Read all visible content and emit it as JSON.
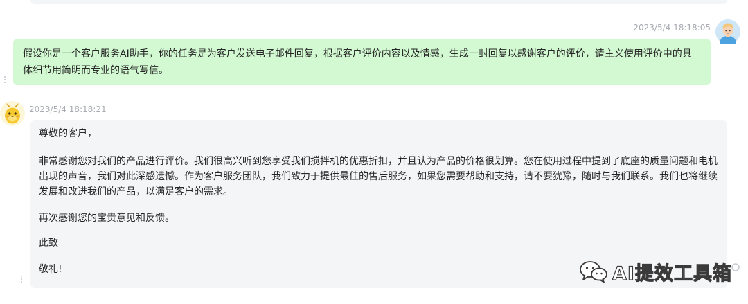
{
  "conversation": {
    "user_message": {
      "timestamp": "2023/5/4 18:18:05",
      "text": "假设你是一个客户服务AI助手，你的任务是为客户发送电子邮件回复，根据客户评价内容以及情感，生成一封回复以感谢客户的评价，请主义使用评价中的具体细节用简明而专业的语气写信。"
    },
    "assistant_message": {
      "timestamp": "2023/5/4 18:18:21",
      "greeting": "尊敬的客户，",
      "body": "非常感谢您对我们的产品进行评价。我们很高兴听到您享受我们搅拌机的优惠折扣，并且认为产品的价格很划算。您在使用过程中提到了底座的质量问题和电机出现的声音，我们对此深感遗憾。作为客户服务团队，我们致力于提供最佳的售后服务，如果您需要帮助和支持，请不要犹豫，随时与我们联系。我们也将继续发展和改进我们的产品，以满足客户的需求。",
      "thanks": "再次感谢您的宝贵意见和反馈。",
      "closing_1": "此致",
      "closing_2": "敬礼!"
    }
  },
  "watermark": {
    "text": "AI提效工具箱",
    "icon": "wechat-icon"
  },
  "colors": {
    "user_bubble": "#d2f9d1",
    "assistant_bubble": "#f4f5f7",
    "timestamp": "#a8abb2",
    "text": "#262626"
  }
}
